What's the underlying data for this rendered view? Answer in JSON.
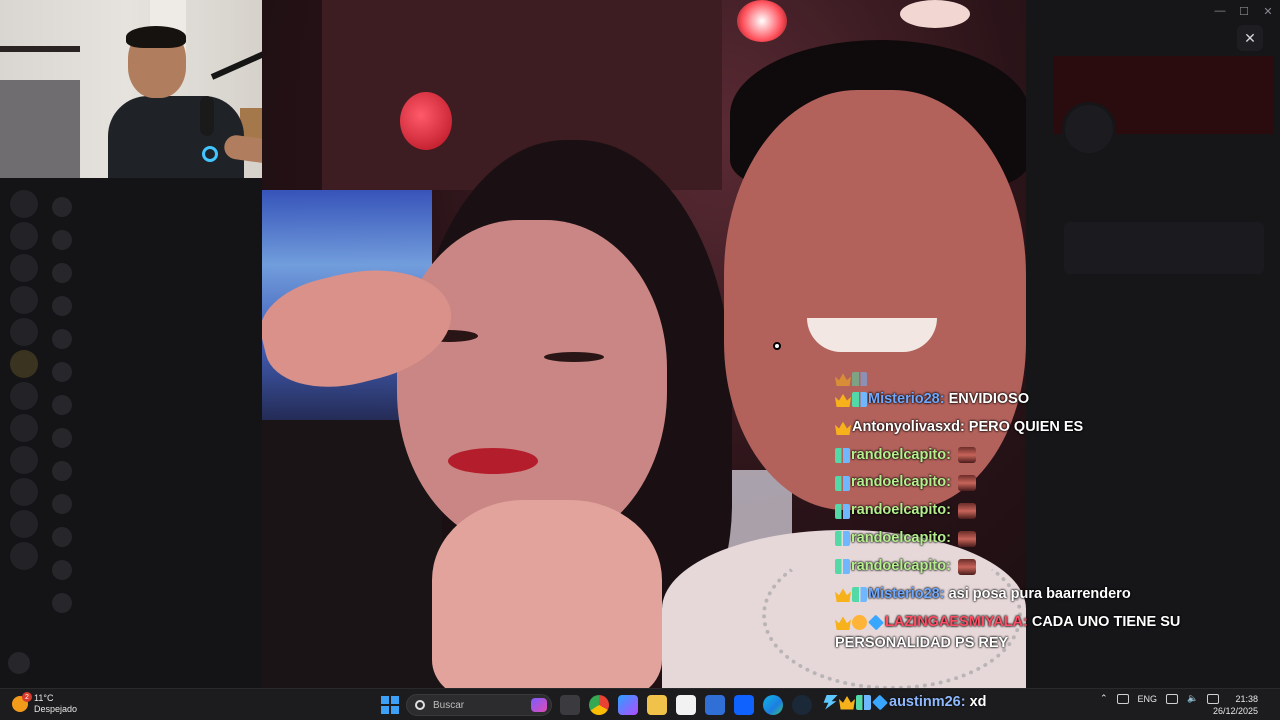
{
  "window": {
    "close_overlay_icon": "close-icon"
  },
  "colors": {
    "chat_username_blue": "#8fb9ff",
    "chat_username_green": "#9ee27a",
    "chat_username_red": "#ff4d63",
    "taskbar_bg": "#1c1c1e"
  },
  "chat": {
    "lines": [
      {
        "badges": [
          "crown",
          "grid"
        ],
        "user": "Misterio28:",
        "user_color": "#6ea8ff",
        "text": "ENVIDIOSO"
      },
      {
        "badges": [
          "crown"
        ],
        "user": "Antonyolivasxd:",
        "user_color": "#ffffff",
        "text": "PERO QUIEN ES"
      },
      {
        "badges": [
          "grid"
        ],
        "user": "randoelcapito:",
        "user_color": "#b6f08e",
        "text": ""
      },
      {
        "badges": [
          "grid"
        ],
        "user": "randoelcapito:",
        "user_color": "#b6f08e",
        "text": ""
      },
      {
        "badges": [
          "grid"
        ],
        "user": "randoelcapito:",
        "user_color": "#b6f08e",
        "text": ""
      },
      {
        "badges": [
          "grid"
        ],
        "user": "randoelcapito:",
        "user_color": "#b6f08e",
        "text": ""
      },
      {
        "badges": [
          "grid"
        ],
        "user": "randoelcapito:",
        "user_color": "#b6f08e",
        "text": ""
      },
      {
        "badges": [
          "crown",
          "grid"
        ],
        "user": "Misterio28:",
        "user_color": "#6ea8ff",
        "text": "asi posa pura baarrendero"
      },
      {
        "badges": [
          "crown",
          "mask",
          "cube"
        ],
        "user": "LAZINGAESMIYALA:",
        "user_color": "#ff4d63",
        "text": "CADA UNO TIENE SU PERSONALIDAD PS REY"
      }
    ],
    "last_line": {
      "user": "austinm26:",
      "text": "xd"
    }
  },
  "taskbar": {
    "weather_temp": "11°C",
    "weather_desc": "Despejado",
    "weather_alert": "2",
    "search_placeholder": "Buscar",
    "language": "ENG",
    "time": "21:38",
    "date": "26/12/2025"
  }
}
